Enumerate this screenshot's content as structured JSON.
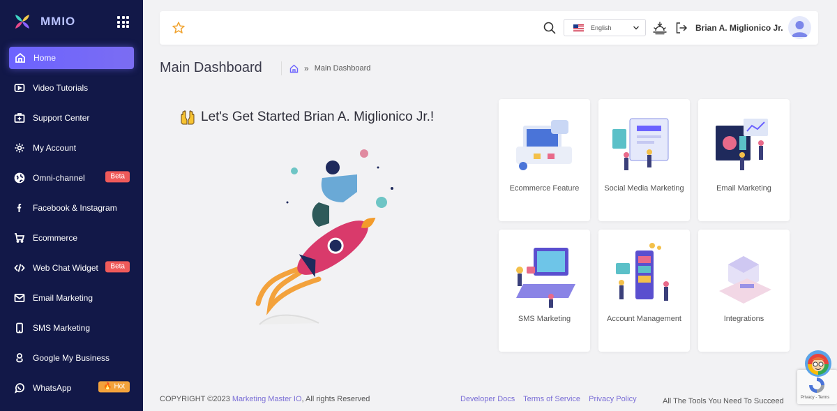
{
  "brand": {
    "name": "MMIO"
  },
  "sidebar": {
    "items": [
      {
        "label": "Home",
        "icon": "home-icon"
      },
      {
        "label": "Video Tutorials",
        "icon": "video-icon"
      },
      {
        "label": "Support Center",
        "icon": "support-icon"
      },
      {
        "label": "My Account",
        "icon": "gear-icon"
      },
      {
        "label": "Omni-channel",
        "icon": "globe-icon",
        "badge": "Beta"
      },
      {
        "label": "Facebook & Instagram",
        "icon": "facebook-icon"
      },
      {
        "label": "Ecommerce",
        "icon": "cart-icon"
      },
      {
        "label": "Web Chat Widget",
        "icon": "code-icon",
        "badge": "Beta"
      },
      {
        "label": "Email Marketing",
        "icon": "mail-icon"
      },
      {
        "label": "SMS Marketing",
        "icon": "phone-icon"
      },
      {
        "label": "Google My Business",
        "icon": "google-icon"
      },
      {
        "label": "WhatsApp",
        "icon": "whatsapp-icon",
        "badge": "Hot"
      }
    ]
  },
  "header": {
    "language": "English",
    "user_name": "Brian A. Miglionico Jr."
  },
  "page": {
    "title": "Main Dashboard",
    "breadcrumb_sep": "»",
    "breadcrumb_current": "Main Dashboard"
  },
  "hero": {
    "title": "Let's Get Started Brian A. Miglionico Jr.!"
  },
  "cards": [
    {
      "label": "Ecommerce Feature"
    },
    {
      "label": "Social Media Marketing"
    },
    {
      "label": "Email Marketing"
    },
    {
      "label": "SMS Marketing"
    },
    {
      "label": "Account Management"
    },
    {
      "label": "Integrations"
    }
  ],
  "footer": {
    "copyright_prefix": "COPYRIGHT ©2023",
    "company_link": "Marketing Master IO",
    "copyright_suffix": ", All rights Reserved",
    "links": [
      "Developer Docs",
      "Terms of Service",
      "Privacy Policy"
    ],
    "tagline": "All The Tools You Need To Succeed"
  },
  "recaptcha": {
    "text": "Privacy - Terms"
  },
  "colors": {
    "sidebar_bg": "#121848",
    "accent": "#6c63ff",
    "beta_badge": "#ef5a5a",
    "hot_badge": "#f3a23c",
    "link": "#7a6ed6"
  }
}
